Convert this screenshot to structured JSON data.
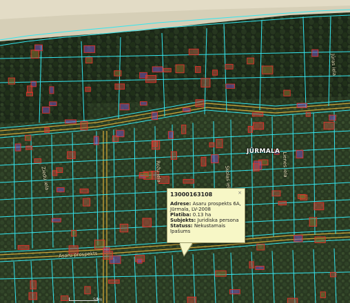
{
  "map": {
    "city_label": "JŪRMALA",
    "street_labels": [
      "Asaru prospekts",
      "Ziedu iela",
      "Rožu iela",
      "Skolas iela",
      "Lienes iela",
      "Jūras iela"
    ],
    "scale_label": "50m",
    "colors": {
      "parcel_line": "#33e6f0",
      "road_line": "#e0b03a",
      "building_outline": "#e0302a",
      "building_fill_purple": "#7a55b8",
      "forest_dark": "#1c2a1a",
      "sand": "#d9d3bd"
    }
  },
  "popup": {
    "parcel_id": "13000163108",
    "close_glyph": "×",
    "rows": [
      {
        "label": "Adrese:",
        "value": "Asaru prospekts 6A, Jūrmala, LV-2008"
      },
      {
        "label": "Platība:",
        "value": "0.13 ha"
      },
      {
        "label": "Subjekts:",
        "value": "Juridiska persona"
      },
      {
        "label": "Statuss:",
        "value": "Nekustamais īpašums"
      }
    ]
  }
}
